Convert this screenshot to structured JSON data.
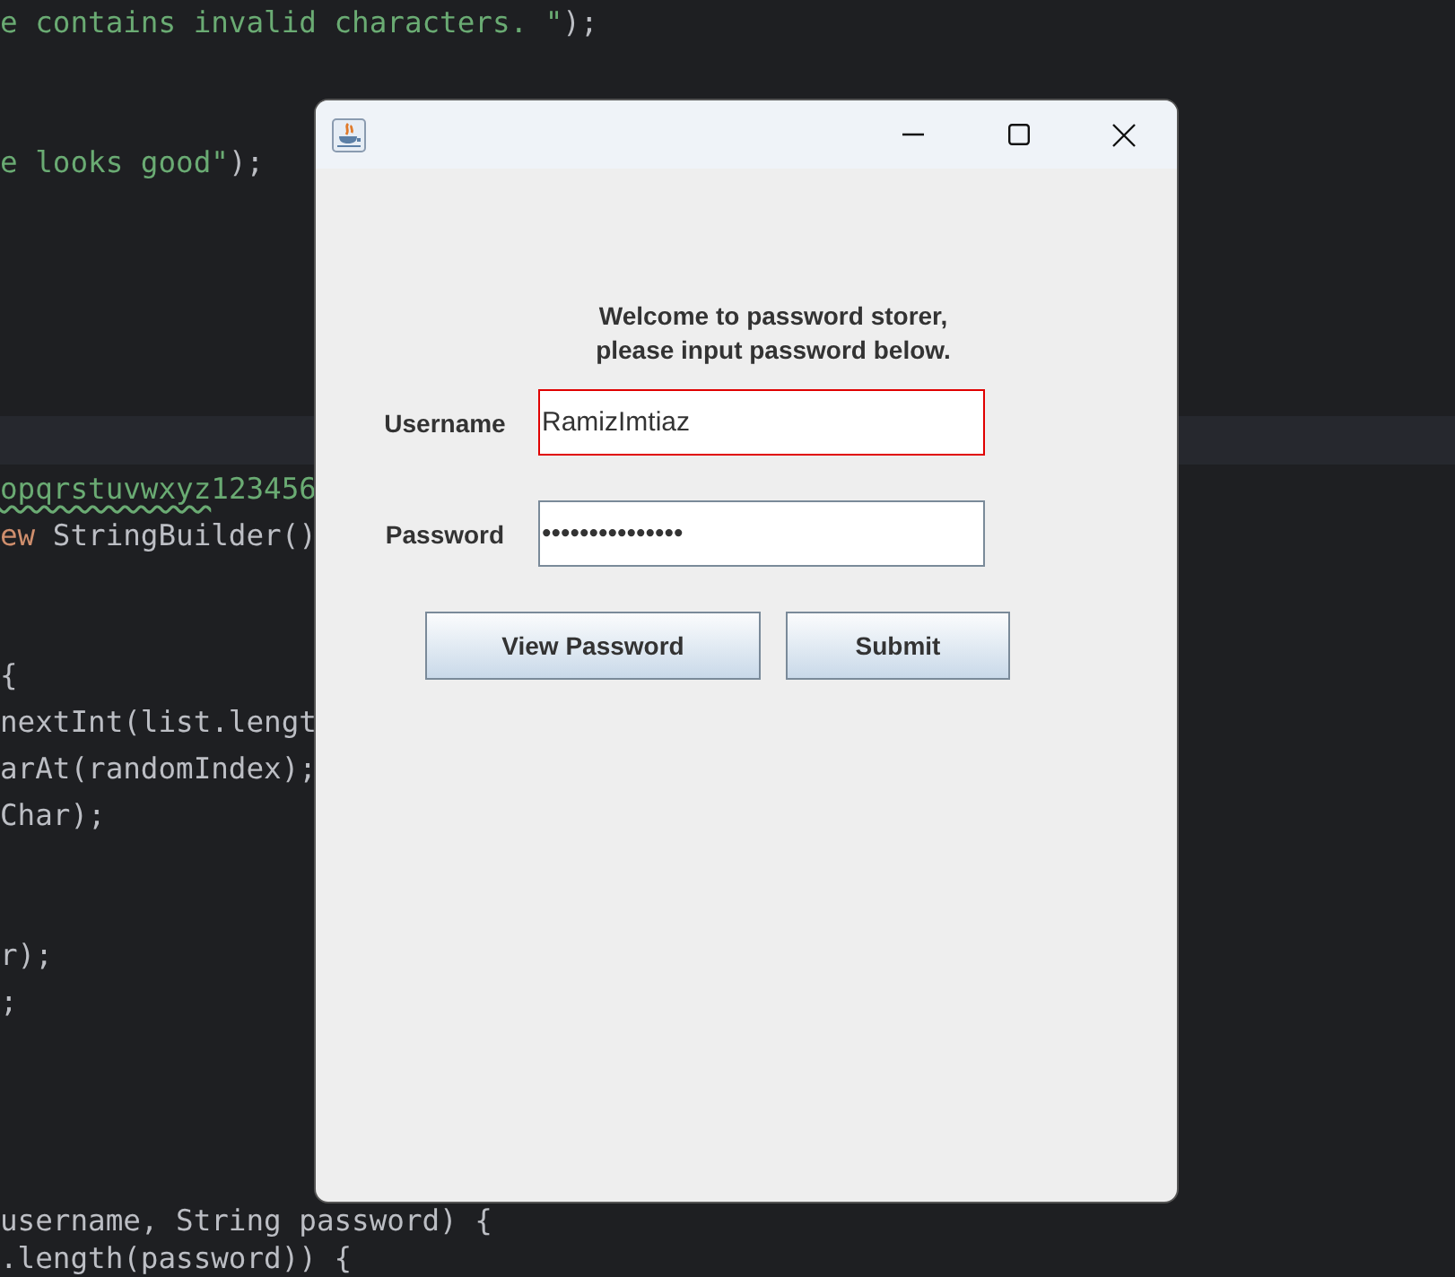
{
  "editor": {
    "blocks": [
      {
        "lines": [
          [
            {
              "kind": "string",
              "text": "e contains invalid characters. \""
            },
            {
              "kind": "plain",
              "text": ");"
            }
          ]
        ]
      },
      {
        "lines": [
          [
            {
              "kind": "string",
              "text": "e looks good\""
            },
            {
              "kind": "plain",
              "text": ");"
            }
          ]
        ]
      },
      {
        "lines": [
          [
            {
              "kind": "warning",
              "text": "opqrstuvwxyz"
            },
            {
              "kind": "string",
              "text": "123456"
            }
          ],
          [
            {
              "kind": "keyword",
              "text": "ew"
            },
            {
              "kind": "plain",
              "text": " StringBuilder()"
            }
          ]
        ]
      },
      {
        "lines": [
          [
            {
              "kind": "plain",
              "text": "{"
            }
          ],
          [
            {
              "kind": "plain",
              "text": "nextInt(list.lengt"
            }
          ],
          [
            {
              "kind": "plain",
              "text": "arAt(randomIndex);"
            }
          ],
          [
            {
              "kind": "plain",
              "text": "Char);"
            }
          ]
        ]
      },
      {
        "lines": [
          [
            {
              "kind": "plain",
              "text": "r);"
            }
          ],
          [
            {
              "kind": "plain",
              "text": ";"
            }
          ]
        ]
      },
      {
        "lines": [
          [
            {
              "kind": "plain",
              "text": "username, String password) {"
            }
          ],
          [
            {
              "kind": "plain",
              "text": ".length(password)) {"
            }
          ]
        ]
      }
    ]
  },
  "window": {
    "welcome": [
      "Welcome to password storer,",
      "please input password below."
    ],
    "fields": [
      {
        "label": "Username",
        "value": "RamizImtiaz",
        "invalid": true
      },
      {
        "label": "Password",
        "value": "•••••••••••••••",
        "invalid": false
      }
    ],
    "buttons": [
      "View Password",
      "Submit"
    ]
  }
}
